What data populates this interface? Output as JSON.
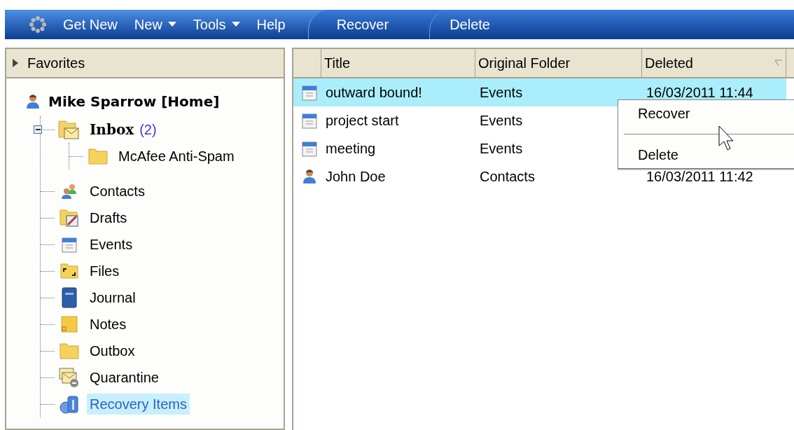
{
  "toolbar": {
    "items": [
      {
        "label": "Get New",
        "dropdown": false
      },
      {
        "label": "New",
        "dropdown": true
      },
      {
        "label": "Tools",
        "dropdown": true
      },
      {
        "label": "Help",
        "dropdown": false
      }
    ],
    "tabs": [
      {
        "label": "Recover"
      },
      {
        "label": "Delete"
      }
    ]
  },
  "sidebar": {
    "favorites": "Favorites",
    "account": "Mike Sparrow [Home]",
    "folders": [
      {
        "label": "Inbox",
        "count": "(2)",
        "kind": "inbox",
        "selected": false,
        "expanded": true,
        "children": [
          {
            "label": "McAfee Anti-Spam",
            "kind": "folder",
            "selected": false
          }
        ]
      },
      {
        "label": "Contacts",
        "kind": "contacts",
        "selected": false
      },
      {
        "label": "Drafts",
        "kind": "drafts",
        "selected": false
      },
      {
        "label": "Events",
        "kind": "calendar",
        "selected": false
      },
      {
        "label": "Files",
        "kind": "files",
        "selected": false
      },
      {
        "label": "Journal",
        "kind": "journal",
        "selected": false
      },
      {
        "label": "Notes",
        "kind": "notes",
        "selected": false
      },
      {
        "label": "Outbox",
        "kind": "folder",
        "selected": false
      },
      {
        "label": "Quarantine",
        "kind": "quarantine",
        "selected": false
      },
      {
        "label": "Recovery Items",
        "kind": "recovery",
        "selected": true
      }
    ]
  },
  "table": {
    "columns": [
      "Title",
      "Original Folder",
      "Deleted"
    ],
    "rows": [
      {
        "kind": "calendar",
        "title": "outward bound!",
        "folder": "Events",
        "deleted": "16/03/2011 11:44",
        "selected": true
      },
      {
        "kind": "calendar",
        "title": "project start",
        "folder": "Events",
        "selected": false
      },
      {
        "kind": "calendar",
        "title": "meeting",
        "folder": "Events",
        "selected": false
      },
      {
        "kind": "person",
        "title": "John Doe",
        "folder": "Contacts",
        "deleted": "16/03/2011 11:42",
        "selected": false
      }
    ]
  },
  "context_menu": {
    "items": [
      {
        "label": "Recover"
      },
      {
        "label": "Delete"
      }
    ]
  }
}
